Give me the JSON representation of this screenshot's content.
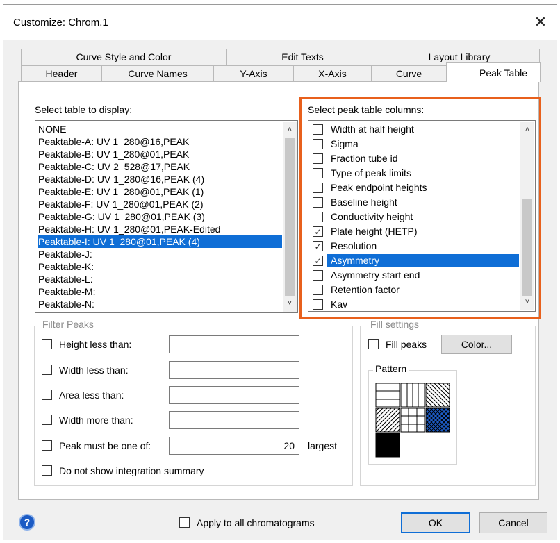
{
  "window": {
    "title": "Customize: Chrom.1",
    "close_glyph": "✕"
  },
  "tabs_back": [
    "Curve Style and Color",
    "Edit Texts",
    "Layout Library"
  ],
  "tabs_front": [
    "Header",
    "Curve Names",
    "Y-Axis",
    "X-Axis",
    "Curve",
    "Peak Table"
  ],
  "active_tab": "Peak Table",
  "table_select": {
    "label": "Select table to display:",
    "items": [
      "NONE",
      "Peaktable-A: UV 1_280@16,PEAK",
      "Peaktable-B: UV 1_280@01,PEAK",
      "Peaktable-C: UV 2_528@17,PEAK",
      "Peaktable-D: UV 1_280@16,PEAK (4)",
      "Peaktable-E: UV 1_280@01,PEAK (1)",
      "Peaktable-F: UV 1_280@01,PEAK (2)",
      "Peaktable-G: UV 1_280@01,PEAK (3)",
      "Peaktable-H: UV 1_280@01,PEAK-Edited",
      "Peaktable-I: UV 1_280@01,PEAK (4)",
      "Peaktable-J:",
      "Peaktable-K:",
      "Peaktable-L:",
      "Peaktable-M:",
      "Peaktable-N:"
    ],
    "selected": "Peaktable-I: UV 1_280@01,PEAK (4)"
  },
  "columns_select": {
    "label": "Select peak table columns:",
    "items": [
      {
        "label": "Width at half height",
        "checked": false
      },
      {
        "label": "Sigma",
        "checked": false
      },
      {
        "label": "Fraction tube id",
        "checked": false
      },
      {
        "label": "Type of peak limits",
        "checked": false
      },
      {
        "label": "Peak endpoint heights",
        "checked": false
      },
      {
        "label": "Baseline height",
        "checked": false
      },
      {
        "label": "Conductivity height",
        "checked": false
      },
      {
        "label": "Plate height (HETP)",
        "checked": true
      },
      {
        "label": "Resolution",
        "checked": true
      },
      {
        "label": "Asymmetry",
        "checked": true
      },
      {
        "label": "Asymmetry start end",
        "checked": false
      },
      {
        "label": "Retention factor",
        "checked": false
      },
      {
        "label": "Kav",
        "checked": false
      }
    ],
    "selected": "Asymmetry",
    "highlight_color": "#e8601c"
  },
  "filter_peaks": {
    "title": "Filter Peaks",
    "height_less_than": "Height less than:",
    "width_less_than": "Width less than:",
    "area_less_than": "Area less than:",
    "width_more_than": "Width more than:",
    "peak_must_be_one_of": "Peak must be one of:",
    "largest_value": "20",
    "largest_label": "largest",
    "no_summary": "Do not show integration summary"
  },
  "fill_settings": {
    "title": "Fill settings",
    "fill_peaks": "Fill peaks",
    "color_button": "Color...",
    "pattern_title": "Pattern"
  },
  "footer": {
    "apply_all": "Apply to all chromatograms",
    "ok": "OK",
    "cancel": "Cancel",
    "help_glyph": "?"
  },
  "colors": {
    "selection": "#0f6ed6",
    "accent": "#e8601c",
    "pattern_selected": "#1c5bc4"
  }
}
